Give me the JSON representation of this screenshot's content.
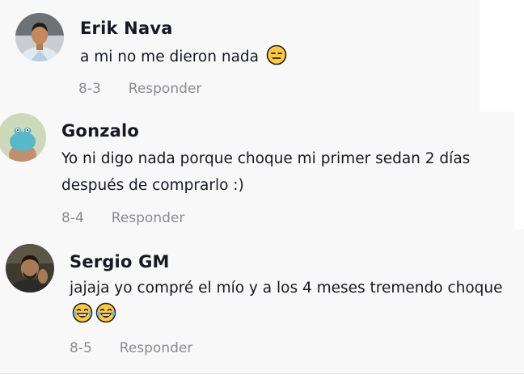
{
  "comments": [
    {
      "author": "Erik Nava",
      "text": "a mi no me dieron nada",
      "emojis": [
        "expressionless-face-icon"
      ],
      "date": "8-3",
      "reply_label": "Responder"
    },
    {
      "author": "Gonzalo",
      "text": "Yo ni digo nada porque choque mi primer sedan 2 días después de comprarlo :)",
      "emojis": [],
      "date": "8-4",
      "reply_label": "Responder"
    },
    {
      "author": "Sergio GM",
      "text": "jajaja yo compré el mío y a los 4 meses tremendo choque",
      "emojis": [
        "tears-of-joy-face-icon",
        "tears-of-joy-face-icon"
      ],
      "date": "8-5",
      "reply_label": "Responder"
    }
  ],
  "colors": {
    "card_background": "#f8f8f8",
    "text": "#161823",
    "meta": "#8a8b91",
    "emoji_yellow": "#ffc83d"
  }
}
